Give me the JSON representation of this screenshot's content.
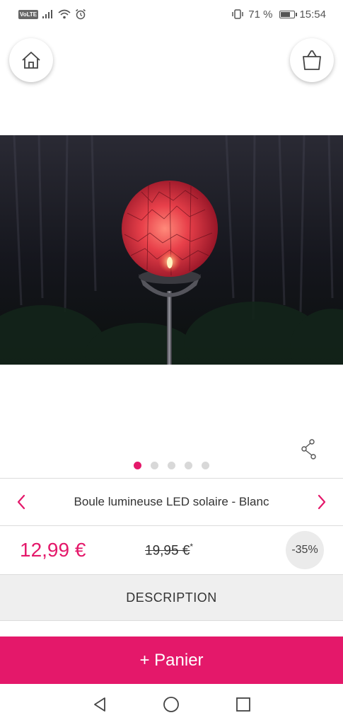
{
  "status_bar": {
    "volte": "VoLTE",
    "battery_text": "71 %",
    "battery_level": 0.71,
    "time": "15:54"
  },
  "header": {
    "home_icon": "home-icon",
    "bag_icon": "shopping-bag-icon"
  },
  "gallery": {
    "image_count": 5,
    "active_index": 0
  },
  "product": {
    "title": "Boule lumineuse LED solaire - Blanc",
    "price": "12,99 €",
    "old_price": "19,95 €",
    "old_price_marker": "*",
    "discount": "-35%"
  },
  "tabs": {
    "description": "DESCRIPTION"
  },
  "cart": {
    "label": "+ Panier"
  },
  "colors": {
    "accent": "#e4186a"
  }
}
